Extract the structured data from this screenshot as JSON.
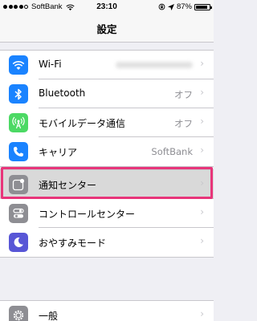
{
  "status_bar": {
    "carrier": "SoftBank",
    "time": "23:10",
    "battery_percent": "87%",
    "battery_level": 0.87
  },
  "nav": {
    "title": "設定"
  },
  "group1": [
    {
      "label": "Wi-Fi",
      "icon": "wifi-icon",
      "color": "#1a83ff",
      "detail": ""
    },
    {
      "label": "Bluetooth",
      "icon": "bluetooth-icon",
      "color": "#1a83ff",
      "detail": "オフ"
    },
    {
      "label": "モバイルデータ通信",
      "icon": "cellular-icon",
      "color": "#4cd964",
      "detail": "オフ"
    },
    {
      "label": "キャリア",
      "icon": "phone-icon",
      "color": "#1a83ff",
      "detail": "SoftBank"
    }
  ],
  "group2": [
    {
      "label": "通知センター",
      "icon": "notification-center-icon",
      "color": "#8e8e93"
    },
    {
      "label": "コントロールセンター",
      "icon": "control-center-icon",
      "color": "#8e8e93"
    },
    {
      "label": "おやすみモード",
      "icon": "moon-icon",
      "color": "#5856d6"
    }
  ],
  "group3": [
    {
      "label": "一般",
      "icon": "gear-icon",
      "color": "#8e8e93"
    }
  ],
  "highlight_color": "#e8357a"
}
